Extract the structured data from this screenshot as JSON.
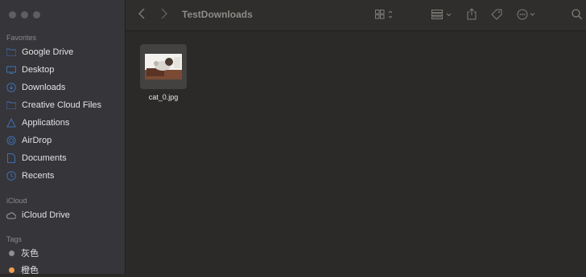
{
  "window": {
    "title": "TestDownloads"
  },
  "sidebar": {
    "sections": [
      {
        "label": "Favorites",
        "items": [
          {
            "label": "Google Drive",
            "icon": "folder-icon"
          },
          {
            "label": "Desktop",
            "icon": "desktop-icon"
          },
          {
            "label": "Downloads",
            "icon": "download-icon"
          },
          {
            "label": "Creative Cloud Files",
            "icon": "folder-icon"
          },
          {
            "label": "Applications",
            "icon": "applications-icon"
          },
          {
            "label": "AirDrop",
            "icon": "airdrop-icon"
          },
          {
            "label": "Documents",
            "icon": "document-icon"
          },
          {
            "label": "Recents",
            "icon": "clock-icon"
          }
        ]
      },
      {
        "label": "iCloud",
        "items": [
          {
            "label": "iCloud Drive",
            "icon": "cloud-icon"
          }
        ]
      },
      {
        "label": "Tags",
        "items": [
          {
            "label": "灰色",
            "color": "#8e8e93"
          },
          {
            "label": "橙色",
            "color": "#f0a04b"
          }
        ]
      }
    ]
  },
  "files": [
    {
      "name": "cat_0.jpg"
    }
  ],
  "colors": {
    "accent": "#3f6fb0",
    "selected_label_bg": "#3a3937"
  }
}
